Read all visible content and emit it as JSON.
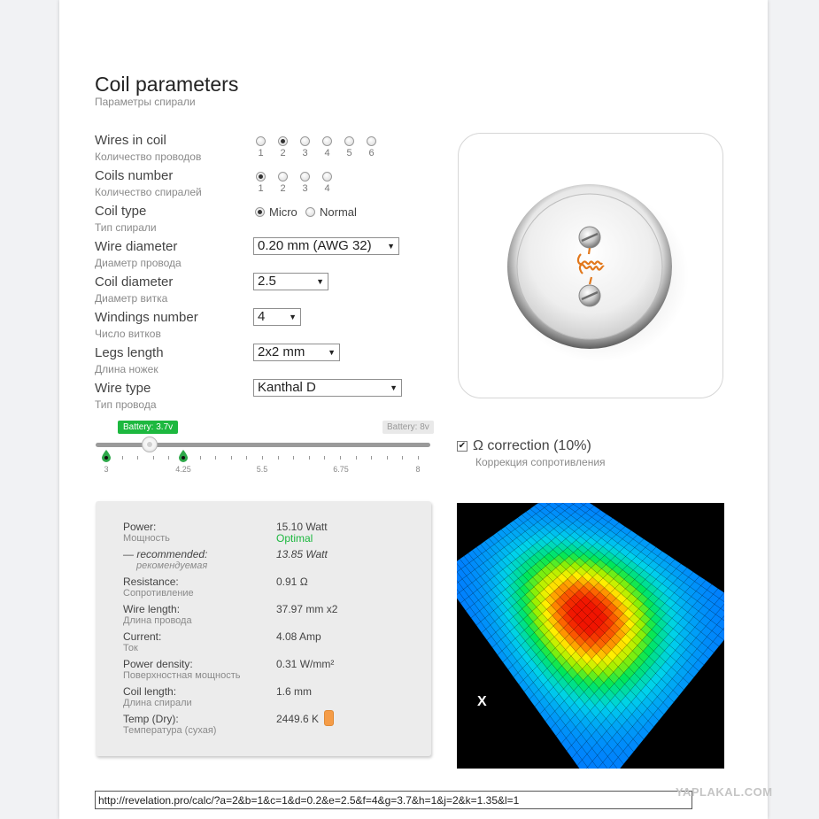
{
  "header": {
    "title": "Coil parameters",
    "subtitle": "Параметры спирали"
  },
  "params": {
    "wires": {
      "label": "Wires in coil",
      "sub": "Количество проводов",
      "options": [
        "1",
        "2",
        "3",
        "4",
        "5",
        "6"
      ],
      "selected": "2"
    },
    "coils": {
      "label": "Coils number",
      "sub": "Количество спиралей",
      "options": [
        "1",
        "2",
        "3",
        "4"
      ],
      "selected": "1"
    },
    "coil_type": {
      "label": "Coil type",
      "sub": "Тип спирали",
      "options": [
        "Micro",
        "Normal"
      ],
      "selected": "Micro"
    },
    "wire_diameter": {
      "label": "Wire diameter",
      "sub": "Диаметр провода",
      "value": "0.20 mm (AWG 32)"
    },
    "coil_diameter": {
      "label": "Coil diameter",
      "sub": "Диаметр витка",
      "value": "2.5"
    },
    "windings": {
      "label": "Windings number",
      "sub": "Число витков",
      "value": "4"
    },
    "legs": {
      "label": "Legs length",
      "sub": "Длина ножек",
      "value": "2x2 mm"
    },
    "wire_type": {
      "label": "Wire type",
      "sub": "Тип провода",
      "value": "Kanthal D"
    }
  },
  "battery": {
    "current_badge": "Battery: 3.7v",
    "max_badge": "Battery: 8v",
    "value": 3.7,
    "min": 3,
    "max": 8,
    "tick_labels": [
      "3",
      "4.25",
      "5.5",
      "6.75",
      "8"
    ]
  },
  "correction": {
    "checked": true,
    "label": "Ω correction (10%)",
    "sub": "Коррекция сопротивления"
  },
  "results": {
    "power_label": "Power:",
    "power_sub": "Мощность",
    "power_value": "15.10 Watt",
    "power_status": "Optimal",
    "recommended_label": "— recommended:",
    "recommended_sub": "рекомендуемая",
    "recommended_value": "13.85 Watt",
    "resistance_label": "Resistance:",
    "resistance_sub": "Сопротивление",
    "resistance_value": "0.91 Ω",
    "wirelen_label": "Wire length:",
    "wirelen_sub": "Длина провода",
    "wirelen_value": "37.97 mm x2",
    "current_label": "Current:",
    "current_sub": "Ток",
    "current_value": "4.08 Amp",
    "density_label": "Power density:",
    "density_sub": "Поверхностная мощность",
    "density_value": "0.31 W/mm²",
    "coillen_label": "Coil length:",
    "coillen_sub": "Длина спирали",
    "coillen_value": "1.6 mm",
    "temp_label": "Temp (Dry):",
    "temp_sub": "Температура (сухая)",
    "temp_value": "2449.6 K",
    "temp_color": "#f59c47"
  },
  "heatmap": {
    "marker": "X"
  },
  "url": "http://revelation.pro/calc/?a=2&b=1&c=1&d=0.2&e=2.5&f=4&g=3.7&h=1&j=2&k=1.35&l=1",
  "watermark": "YAPLAKAL.COM"
}
